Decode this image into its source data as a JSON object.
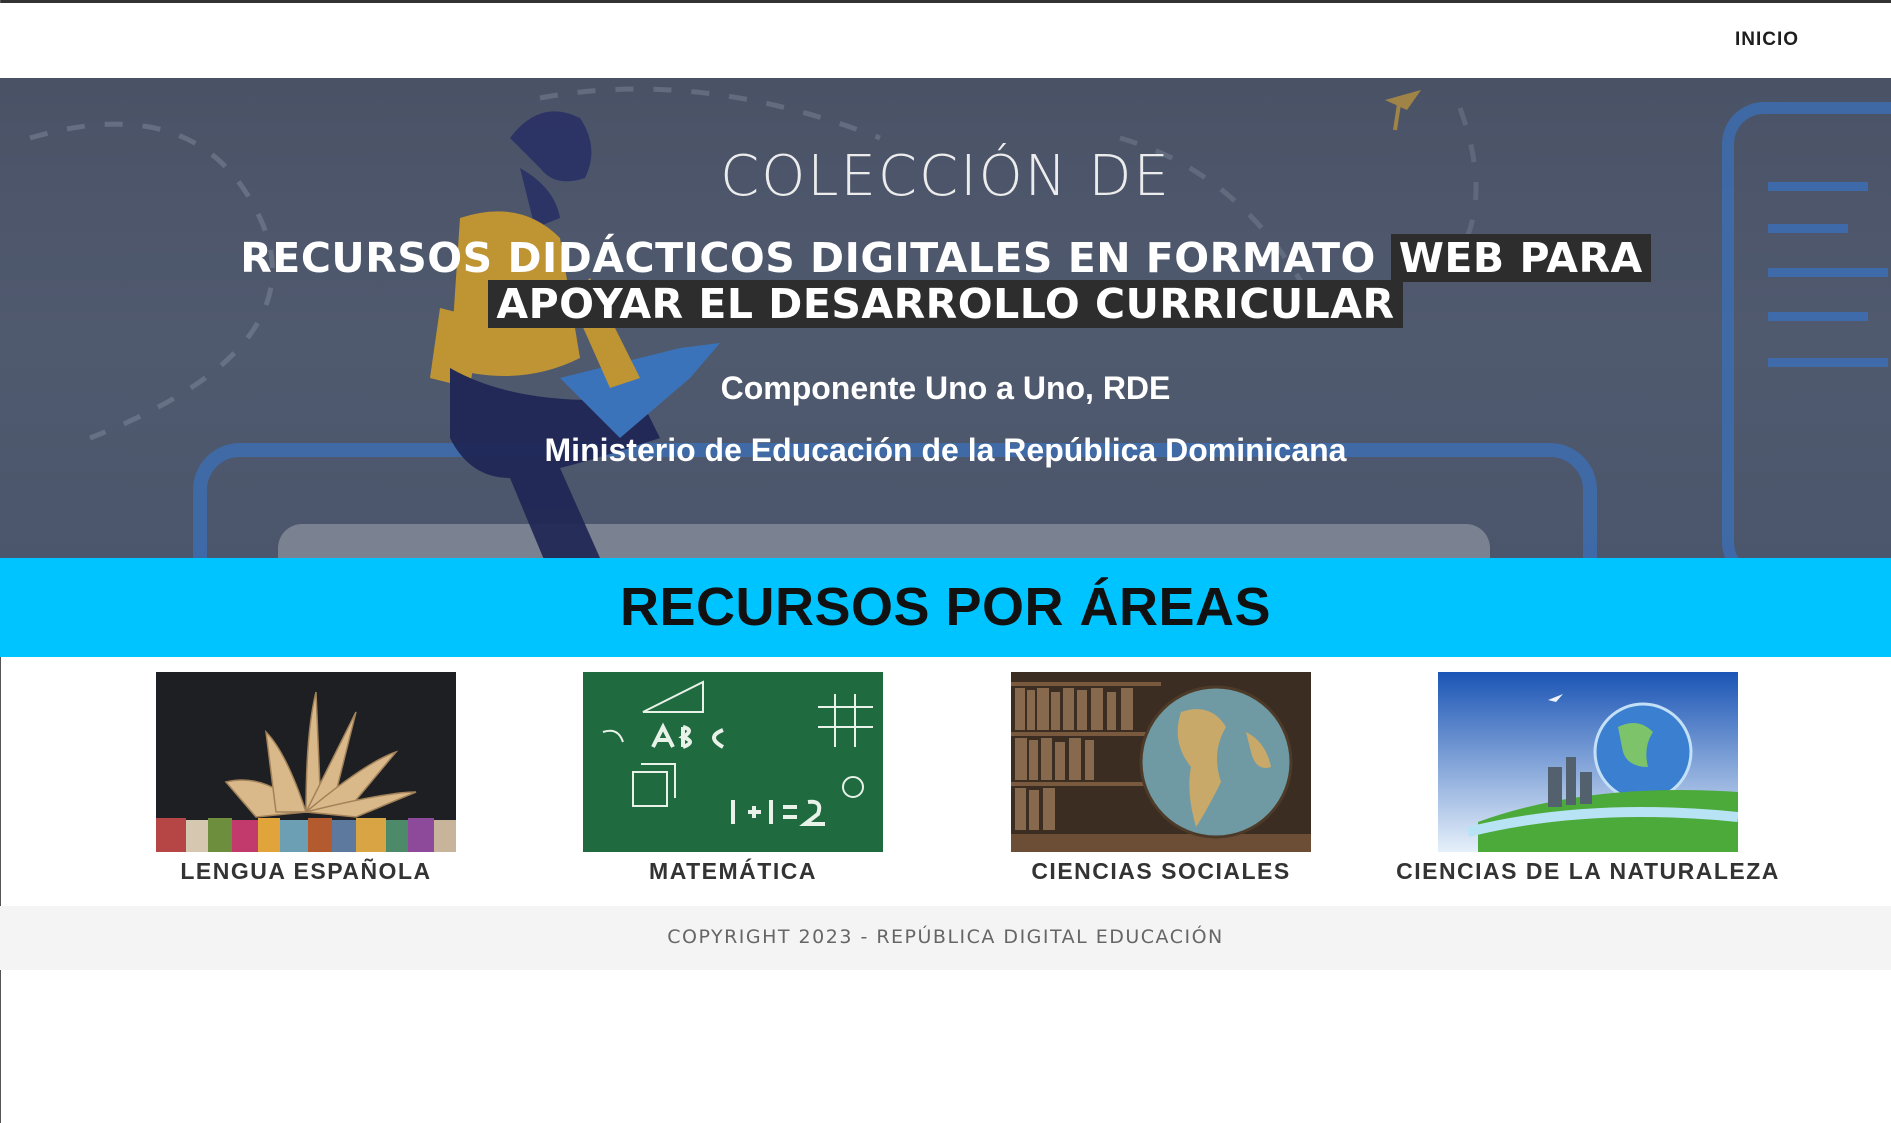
{
  "nav": {
    "items": [
      {
        "label": "INICIO"
      }
    ]
  },
  "hero": {
    "kicker": "COLECCIÓN DE",
    "title_plain": "RECURSOS DIDÁCTICOS DIGITALES EN FORMATO ",
    "title_highlight": "WEB PARA APOYAR EL DESARROLLO CURRICULAR",
    "subtitle_1": "Componente Uno a Uno, RDE",
    "subtitle_2": "Ministerio de Educación de la República Dominicana"
  },
  "areas": {
    "title": "RECURSOS POR ÁREAS",
    "items": [
      {
        "label": "LENGUA ESPAÑOLA",
        "image": "books-image"
      },
      {
        "label": "MATEMÁTICA",
        "image": "chalkboard-math-image"
      },
      {
        "label": "CIENCIAS SOCIALES",
        "image": "globe-library-image"
      },
      {
        "label": "CIENCIAS DE LA NATURALEZA",
        "image": "earth-nature-image"
      }
    ]
  },
  "footer": {
    "copyright": "COPYRIGHT 2023 - REPÚBLICA DIGITAL EDUCACIÓN"
  },
  "colors": {
    "areas_banner": "#00c4ff",
    "hero_overlay": "#4d566b",
    "title_highlight": "#2d2d2d",
    "footer_bg": "#f4f4f4"
  }
}
